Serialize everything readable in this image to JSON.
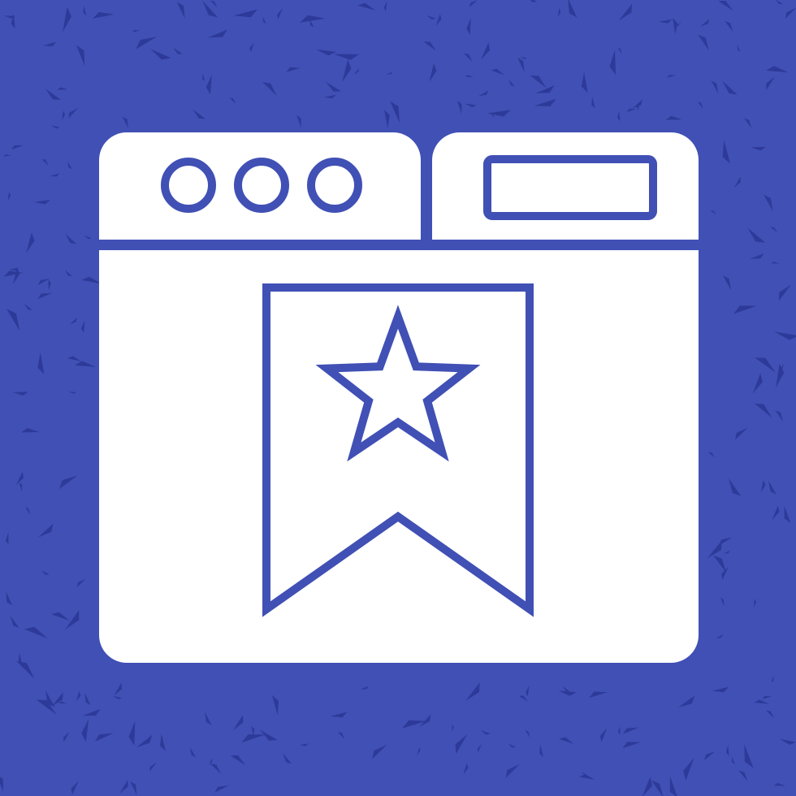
{
  "colors": {
    "background": "#4050B5",
    "speckle": "#2E3A99",
    "foreground": "#FFFFFF",
    "line": "#4050B5"
  },
  "icon": {
    "name": "browser-bookmark-icon",
    "window_dots": 3,
    "parts": [
      "browser-window",
      "window-control-dots",
      "address-bar",
      "bookmark-ribbon",
      "star"
    ]
  }
}
